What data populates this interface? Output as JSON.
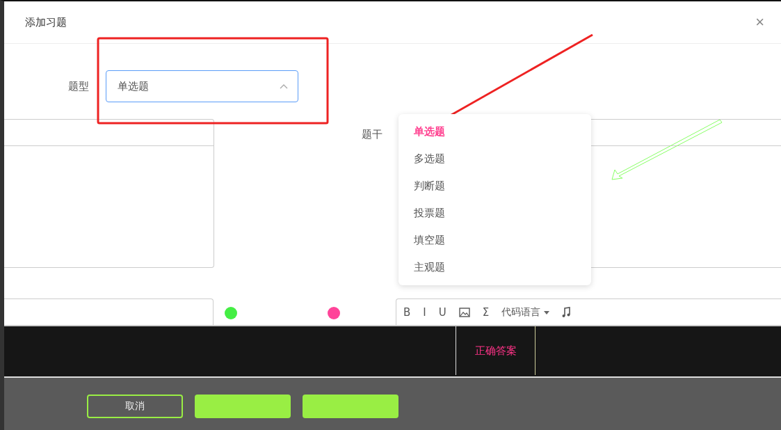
{
  "dialog": {
    "title": "添加习题",
    "close": "×"
  },
  "type_field": {
    "label": "题型",
    "value": "单选题",
    "expanded": true
  },
  "type_options": [
    {
      "label": "单选题",
      "selected": true
    },
    {
      "label": "多选题",
      "selected": false
    },
    {
      "label": "判断题",
      "selected": false
    },
    {
      "label": "投票题",
      "selected": false
    },
    {
      "label": "填空题",
      "selected": false
    },
    {
      "label": "主观题",
      "selected": false
    }
  ],
  "stem_label": "题干",
  "editor_toolbar": [
    {
      "kind": "text",
      "text": "B"
    },
    {
      "kind": "text",
      "text": "I"
    },
    {
      "kind": "text",
      "text": "U"
    },
    {
      "kind": "image"
    },
    {
      "kind": "text",
      "text": "Σ"
    },
    {
      "kind": "dropdown",
      "text": "代码语言"
    },
    {
      "kind": "music"
    }
  ],
  "correct_answer_label": "正确答案",
  "footer": {
    "cancel": "取消"
  }
}
